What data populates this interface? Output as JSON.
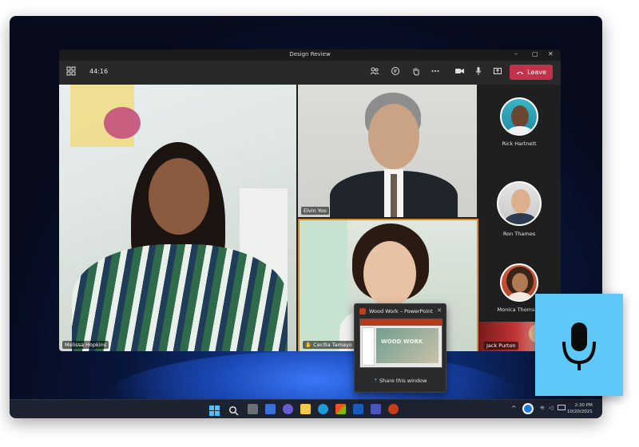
{
  "window": {
    "title": "Design Review",
    "controls": [
      "–",
      "▢",
      "✕"
    ]
  },
  "toolbar": {
    "timer": "44:16",
    "leave_label": "Leave",
    "icons": [
      "layout-grid-icon",
      "participants-icon",
      "chat-icon",
      "raise-hand-icon",
      "more-icon",
      "camera-icon",
      "mic-icon",
      "share-icon"
    ]
  },
  "participants": {
    "main": [
      {
        "name": "Melissa Hopkins"
      },
      {
        "name": "Elvin Yoo"
      },
      {
        "name": "Cecilia Tamayo"
      }
    ],
    "rail": [
      {
        "name": "Rick Hartnett"
      },
      {
        "name": "Ron Thames"
      },
      {
        "name": "Monica Thomson"
      },
      {
        "name": "Jack Purton"
      }
    ]
  },
  "share_popup": {
    "window_title": "Wood Work – PowerPoint",
    "slide_text": "WOOD WORK",
    "action_label": "Share this window"
  },
  "taskbar": {
    "time": "2:30 PM",
    "date": "10/20/2021"
  },
  "colors": {
    "leave": "#c4314b",
    "active_speaker_border": "#d98c2b",
    "mic_card": "#5ec8f9"
  }
}
